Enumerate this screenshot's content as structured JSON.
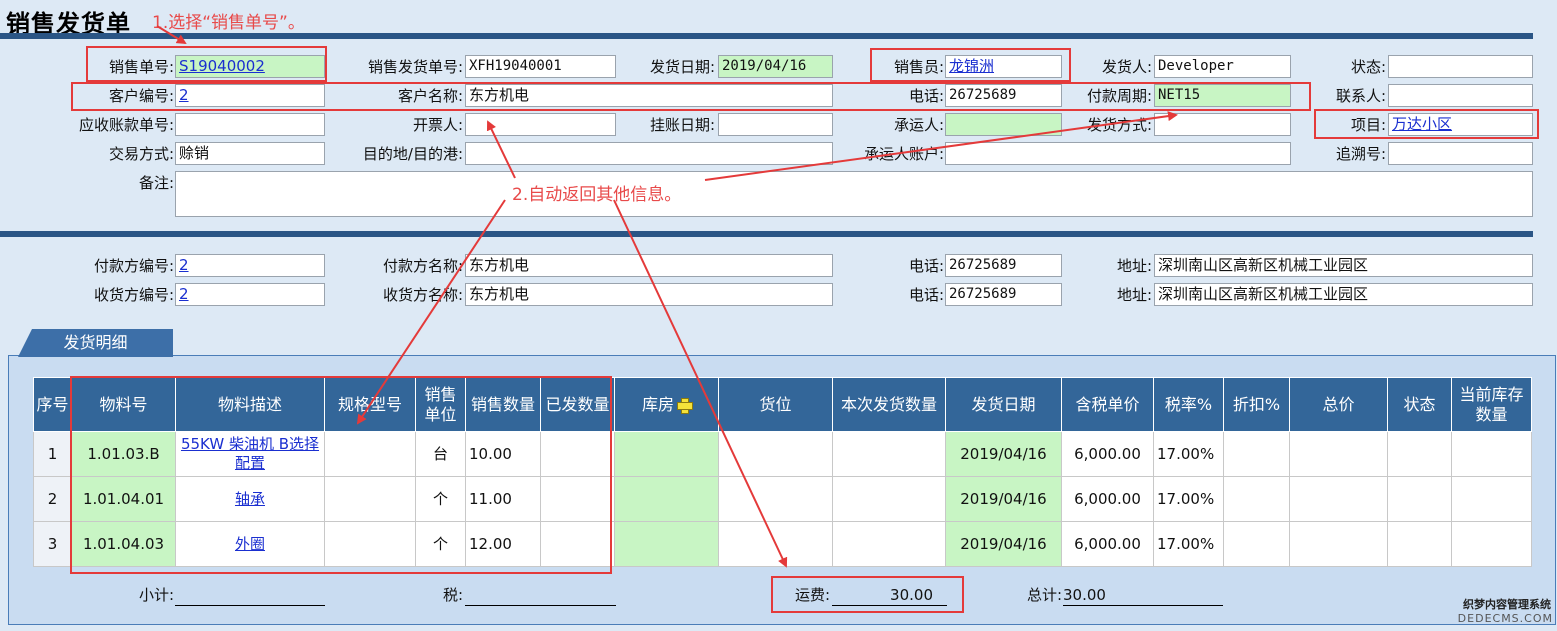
{
  "page": {
    "title": "销售发货单"
  },
  "annotations": {
    "step1": "1.选择“销售单号”。",
    "step2": "2.自动返回其他信息。",
    "color": "#e43a3a"
  },
  "header": {
    "sales_order_no": {
      "label": "销售单号:",
      "value": "S19040002"
    },
    "ship_order_no": {
      "label": "销售发货单号:",
      "value": "XFH19040001"
    },
    "ship_date": {
      "label": "发货日期:",
      "value": "2019/04/16"
    },
    "salesperson": {
      "label": "销售员:",
      "value": "龙锦洲"
    },
    "shipper": {
      "label": "发货人:",
      "value": "Developer"
    },
    "status": {
      "label": "状态:",
      "value": ""
    },
    "customer_no": {
      "label": "客户编号:",
      "value": "2"
    },
    "customer_name": {
      "label": "客户名称:",
      "value": "东方机电"
    },
    "phone": {
      "label": "电话:",
      "value": "26725689"
    },
    "payment_term": {
      "label": "付款周期:",
      "value": "NET15"
    },
    "contact": {
      "label": "联系人:",
      "value": ""
    },
    "ar_no": {
      "label": "应收账款单号:",
      "value": ""
    },
    "invoicer": {
      "label": "开票人:",
      "value": ""
    },
    "posting_date": {
      "label": "挂账日期:",
      "value": ""
    },
    "carrier": {
      "label": "承运人:",
      "value": ""
    },
    "ship_method": {
      "label": "发货方式:",
      "value": ""
    },
    "project": {
      "label": "项目:",
      "value": "万达小区"
    },
    "trade_method": {
      "label": "交易方式:",
      "value": "赊销"
    },
    "destination": {
      "label": "目的地/目的港:",
      "value": ""
    },
    "carrier_account": {
      "label": "承运人账户:",
      "value": ""
    },
    "trace_no": {
      "label": "追溯号:",
      "value": ""
    },
    "remarks": {
      "label": "备注:",
      "value": ""
    }
  },
  "parties": {
    "payer_no": {
      "label": "付款方编号:",
      "value": "2"
    },
    "payer_name": {
      "label": "付款方名称:",
      "value": "东方机电"
    },
    "payer_phone": {
      "label": "电话:",
      "value": "26725689"
    },
    "payer_address": {
      "label": "地址:",
      "value": "深圳南山区高新区机械工业园区"
    },
    "consignee_no": {
      "label": "收货方编号:",
      "value": "2"
    },
    "consignee_name": {
      "label": "收货方名称:",
      "value": "东方机电"
    },
    "consignee_phone": {
      "label": "电话:",
      "value": "26725689"
    },
    "consignee_address": {
      "label": "地址:",
      "value": "深圳南山区高新区机械工业园区"
    }
  },
  "tab": {
    "label": "发货明细"
  },
  "table": {
    "columns": [
      "序号",
      "物料号",
      "物料描述",
      "规格型号",
      "销售单位",
      "销售数量",
      "已发数量",
      "库房",
      "货位",
      "本次发货数量",
      "发货日期",
      "含税单价",
      "税率%",
      "折扣%",
      "总价",
      "状态",
      "当前库存数量"
    ],
    "rows": [
      {
        "idx": "1",
        "item_no": "1.01.03.B",
        "desc": "55KW 柴油机  B选择配置",
        "spec": "",
        "unit": "台",
        "qty": "10.00",
        "shipped": "",
        "warehouse": "",
        "location": "",
        "ship_qty": "",
        "date": "2019/04/16",
        "price": "6,000.00",
        "tax": "17.00%",
        "discount": "",
        "total": "",
        "status": "",
        "stock": ""
      },
      {
        "idx": "2",
        "item_no": "1.01.04.01",
        "desc": "轴承",
        "spec": "",
        "unit": "个",
        "qty": "11.00",
        "shipped": "",
        "warehouse": "",
        "location": "",
        "ship_qty": "",
        "date": "2019/04/16",
        "price": "6,000.00",
        "tax": "17.00%",
        "discount": "",
        "total": "",
        "status": "",
        "stock": ""
      },
      {
        "idx": "3",
        "item_no": "1.01.04.03",
        "desc": "外圈",
        "spec": "",
        "unit": "个",
        "qty": "12.00",
        "shipped": "",
        "warehouse": "",
        "location": "",
        "ship_qty": "",
        "date": "2019/04/16",
        "price": "6,000.00",
        "tax": "17.00%",
        "discount": "",
        "total": "",
        "status": "",
        "stock": ""
      }
    ]
  },
  "footer": {
    "subtotal": {
      "label": "小计:",
      "value": ""
    },
    "tax": {
      "label": "税:",
      "value": ""
    },
    "freight": {
      "label": "运费:",
      "value": "30.00"
    },
    "total": {
      "label": "总计:",
      "value": "30.00"
    }
  },
  "watermark": {
    "line1": "织梦内容管理系统",
    "line2": "DEDECMS.COM"
  }
}
